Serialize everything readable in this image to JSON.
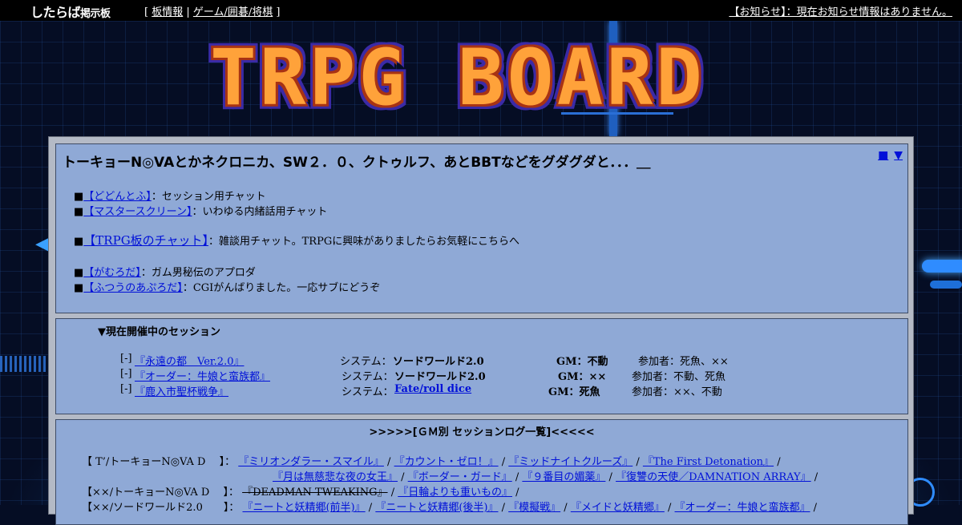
{
  "topbar": {
    "logo": "したらば",
    "logo_sub": "掲示板",
    "nav_open": "[",
    "nav_board_info": "板情報",
    "nav_sep": "|",
    "nav_category": "ゲーム/囲碁/将棋",
    "nav_close": "]",
    "notice": "【お知らせ】：現在お知らせ情報はありません。"
  },
  "hero": {
    "title": "TRPG BOARD"
  },
  "board": {
    "title": "トーキョーN◎VAとかネクロニカ、SW２．０、クトゥルフ、あとBBTなどをグダグダと．．．＿",
    "corner_square": "■",
    "corner_down": "▼",
    "links": [
      {
        "bullet": "■",
        "label": "【どどんとふ】",
        "desc": "：セッション用チャット"
      },
      {
        "bullet": "■",
        "label": "【マスタースクリーン】",
        "desc": "：いわゆる内緒話用チャット"
      },
      {
        "bullet": "■",
        "label": "【TRPG板のチャット】",
        "desc": "：雑談用チャット。TRPGに興味がありましたらお気軽にこちらへ"
      },
      {
        "bullet": "■",
        "label": "【がむろだ】",
        "desc": "：ガム男秘伝のアプロダ"
      },
      {
        "bullet": "■",
        "label": "【ふつうのあぷろだ】",
        "desc": "：CGIがんばりました。一応サブにどうぞ"
      }
    ]
  },
  "sessions": {
    "heading": "▼現在開催中のセッション",
    "system_label": "システム：",
    "rows": [
      {
        "marker": "[-]",
        "title": "『永遠の都　Ver.2.0』",
        "system": "ソードワールド2.0",
        "gm": "GM：不動",
        "members": "参加者：死魚、××"
      },
      {
        "marker": "[-]",
        "title": "『オーダー：牛娘と蛮族都』",
        "system": "ソードワールド2.0",
        "gm": "GM：××",
        "members": "参加者：不動、死魚"
      },
      {
        "marker": "[-]",
        "title": "『鹿入市聖杯戦争』",
        "system": "Fate/roll dice",
        "gm": "GM：死魚",
        "members": "参加者：××、不動"
      }
    ]
  },
  "logs": {
    "heading": ">>>>>[ＧＭ別 セッションログ一覧]<<<<<",
    "slash": "/",
    "row1": {
      "label": "【 T’/トーキョーN◎VA D　 】：",
      "items": [
        "『ミリオンダラー・スマイル』",
        "『カウント・ゼロ！』",
        "『ミッドナイトクルーズ』",
        "『The First Detonation』"
      ]
    },
    "row1b": {
      "items": [
        "『月は無慈悲な夜の女王』",
        "『ボーダー・ガード』",
        "『９番目の媚薬』",
        "『復讐の天使／DAMNATION ARRAY』"
      ]
    },
    "row2": {
      "label": "【××/トーキョーN◎VA D　 】：",
      "struck": "『DEADMAN TWEAKING』",
      "items": [
        "『日輪よりも重いもの』"
      ]
    },
    "row3": {
      "label": "【××/ソードワールド2.0　　】：",
      "items": [
        "『ニートと妖精郷(前半)』",
        "『ニートと妖精郷(後半)』",
        "『模擬戦』",
        "『メイドと妖精郷』",
        "『オーダー：牛娘と蛮族都』"
      ]
    }
  },
  "colors": {
    "link": "#0010d8",
    "panel": "#8fa9d6",
    "frame": "#b4bac6",
    "hero": "#ffa23a"
  }
}
